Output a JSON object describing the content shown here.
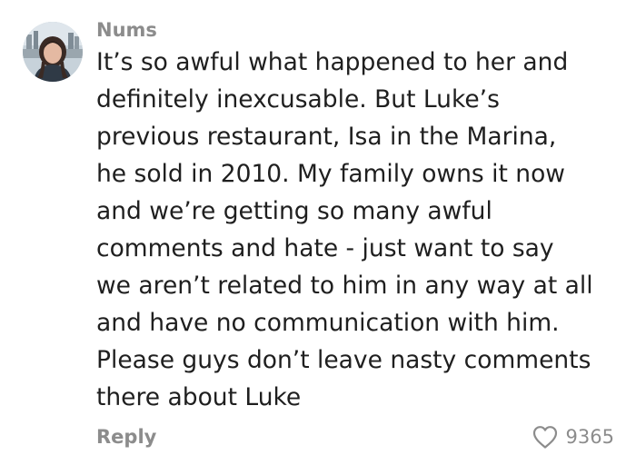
{
  "comment": {
    "username": "Nums",
    "text_lines": [
      "It’s so awful what happened to her and",
      "definitely inexcusable. But Luke’s",
      "previous restaurant, Isa in the Marina,",
      "he sold in 2010. My family owns it now",
      "and we’re getting so many awful",
      "comments and hate - just want to say",
      "we aren’t related to him in any way at all",
      "and have no communication with him.",
      "Please guys don’t leave nasty comments",
      "there about Luke"
    ],
    "reply_label": "Reply",
    "like_count": "9365",
    "like_icon": "heart-outline-icon"
  },
  "colors": {
    "meta_text": "#8c8c8c",
    "body_text": "#1f1f1f",
    "background": "#ffffff"
  }
}
